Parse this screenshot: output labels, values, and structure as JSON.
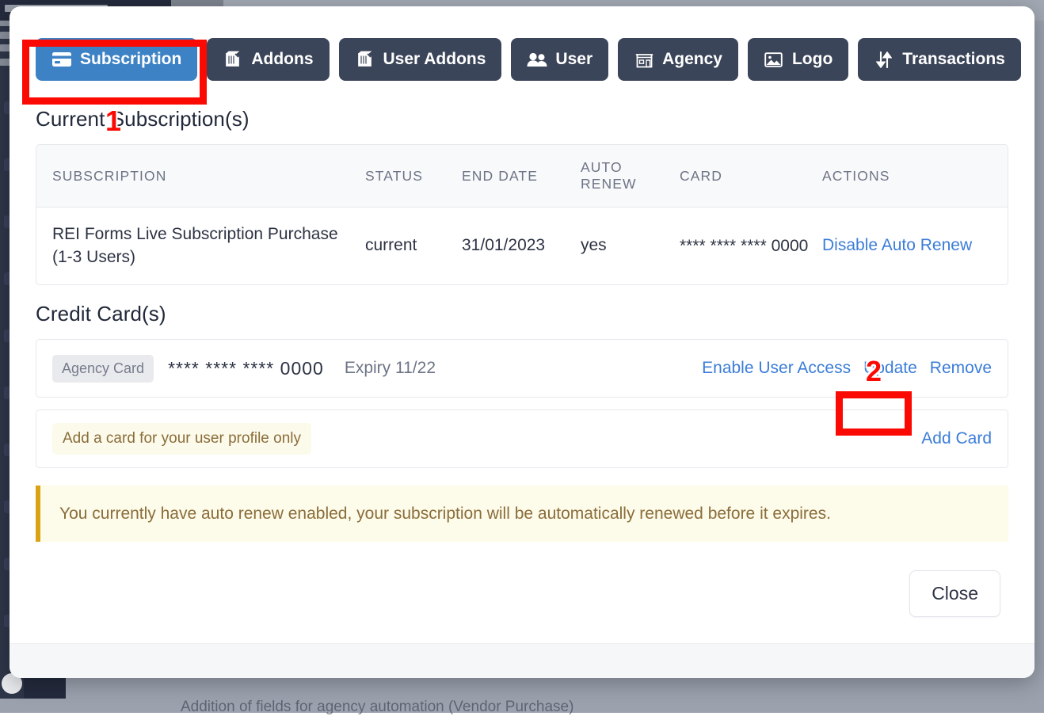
{
  "background": {
    "bottom_caption": "Addition of fields for agency automation (Vendor Purchase)"
  },
  "modal": {
    "tabs": [
      {
        "label": "Subscription",
        "icon": "credit-card-icon",
        "active": true
      },
      {
        "label": "Addons",
        "icon": "box-icon",
        "active": false
      },
      {
        "label": "User Addons",
        "icon": "box-icon",
        "active": false
      },
      {
        "label": "User",
        "icon": "users-icon",
        "active": false
      },
      {
        "label": "Agency",
        "icon": "storefront-icon",
        "active": false
      },
      {
        "label": "Logo",
        "icon": "image-icon",
        "active": false
      },
      {
        "label": "Transactions",
        "icon": "sort-arrows-icon",
        "active": false
      }
    ],
    "subscriptions": {
      "title": "Current Subscription(s)",
      "columns": [
        "SUBSCRIPTION",
        "STATUS",
        "END DATE",
        "AUTO RENEW",
        "CARD",
        "ACTIONS"
      ],
      "rows": [
        {
          "subscription": "REI Forms Live Subscription Purchase (1-3 Users)",
          "status": "current",
          "end_date": "31/01/2023",
          "auto_renew": "yes",
          "card_masked": "**** **** ****",
          "card_last4": "0000",
          "action": "Disable Auto Renew"
        }
      ]
    },
    "credit_cards": {
      "title": "Credit Card(s)",
      "card": {
        "badge": "Agency Card",
        "masked": "**** **** ****",
        "last4": "0000",
        "expiry": "Expiry 11/22",
        "actions": [
          "Enable User Access",
          "Update",
          "Remove"
        ]
      },
      "add_row": {
        "note": "Add a card for your user profile only",
        "action": "Add Card"
      }
    },
    "alert": {
      "message": "You currently have auto renew enabled, your subscription will be automatically renewed before it expires."
    },
    "footer": {
      "close_label": "Close"
    }
  },
  "annotations": [
    {
      "number": "1",
      "target": "Subscription tab"
    },
    {
      "number": "2",
      "target": "Update card link"
    }
  ],
  "colors": {
    "tab_active": "#3d82c4",
    "tab_inactive": "#3b4559",
    "link": "#3b7dd8",
    "alert_bg": "#fdfbe9",
    "alert_border": "#d9a313",
    "annotation_red": "#fb0a03"
  }
}
